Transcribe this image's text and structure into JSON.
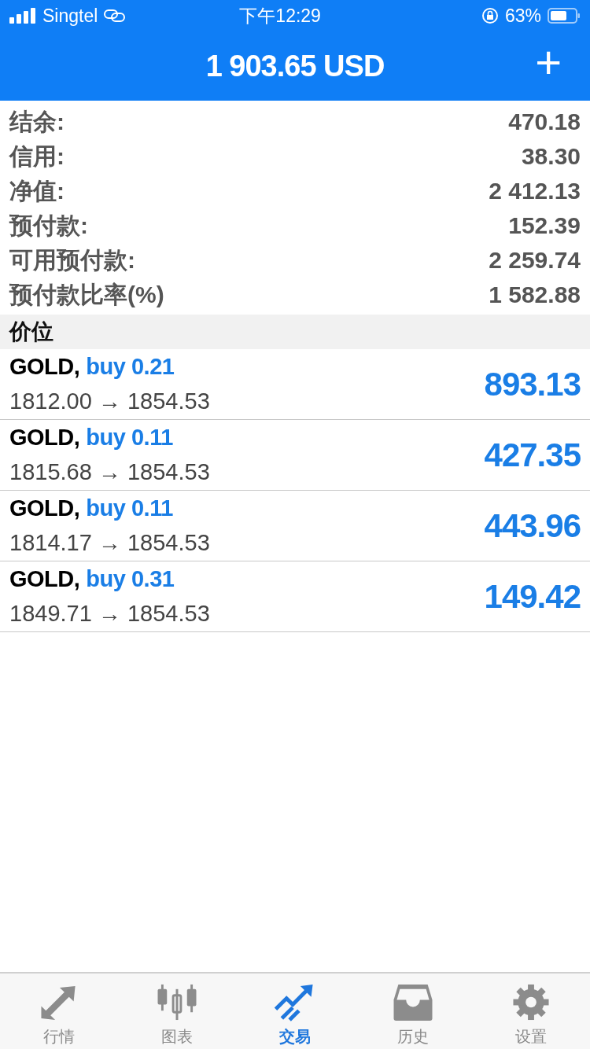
{
  "status_bar": {
    "carrier": "Singtel",
    "time": "下午12:29",
    "battery": "63%"
  },
  "header": {
    "title": "1 903.65 USD",
    "add_button": "+"
  },
  "summary": [
    {
      "label": "结余:",
      "value": "470.18"
    },
    {
      "label": "信用:",
      "value": "38.30"
    },
    {
      "label": "净值:",
      "value": "2 412.13"
    },
    {
      "label": "预付款:",
      "value": "152.39"
    },
    {
      "label": "可用预付款:",
      "value": "2 259.74"
    },
    {
      "label": "预付款比率(%)",
      "value": "1 582.88"
    }
  ],
  "section_title": "价位",
  "positions": [
    {
      "symbol": "GOLD,",
      "order": "buy 0.21",
      "prices": "1812.00 → 1854.53",
      "profit": "893.13"
    },
    {
      "symbol": "GOLD,",
      "order": "buy 0.11",
      "prices": "1815.68 → 1854.53",
      "profit": "427.35"
    },
    {
      "symbol": "GOLD,",
      "order": "buy 0.11",
      "prices": "1814.17 → 1854.53",
      "profit": "443.96"
    },
    {
      "symbol": "GOLD,",
      "order": "buy 0.31",
      "prices": "1849.71 → 1854.53",
      "profit": "149.42"
    }
  ],
  "tabs": [
    {
      "label": "行情",
      "kind": "quotes",
      "selected": false
    },
    {
      "label": "图表",
      "kind": "chart",
      "selected": false
    },
    {
      "label": "交易",
      "kind": "trade",
      "selected": true
    },
    {
      "label": "历史",
      "kind": "history",
      "selected": false
    },
    {
      "label": "设置",
      "kind": "settings",
      "selected": false
    }
  ]
}
